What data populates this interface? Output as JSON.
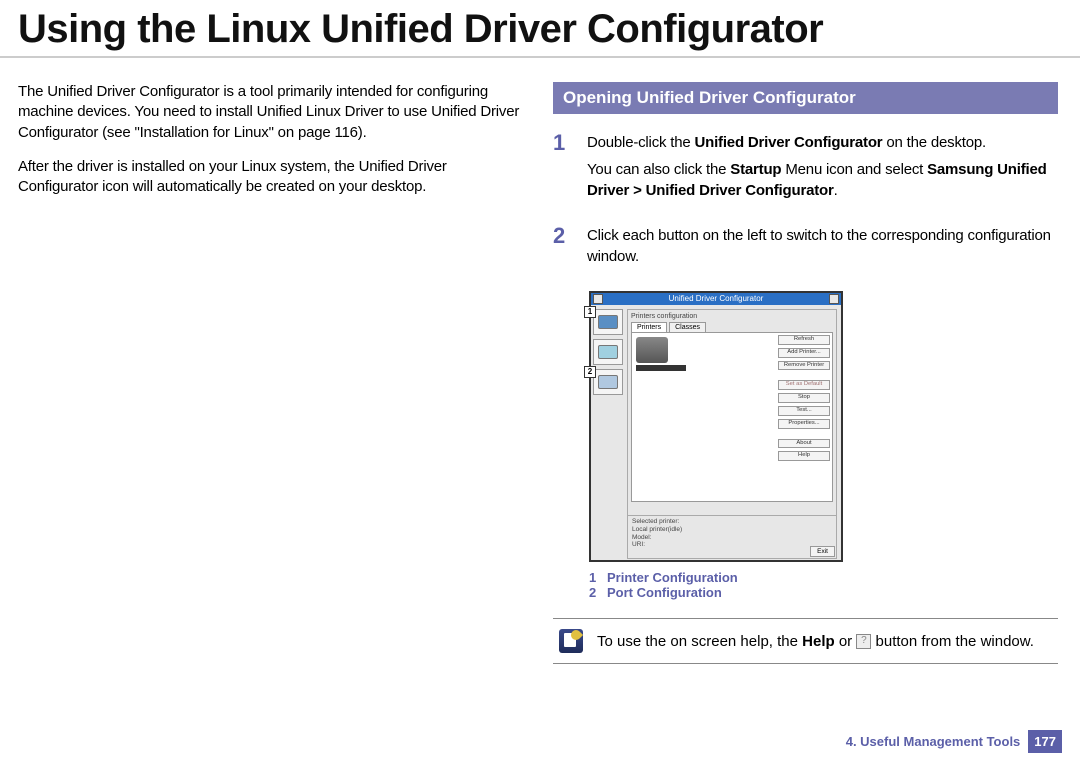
{
  "title": "Using the Linux Unified Driver Configurator",
  "intro": {
    "p1": "The Unified Driver Configurator is a tool primarily intended for configuring machine devices. You need to install Unified Linux Driver to use Unified Driver Configurator (see \"Installation for Linux\" on page 116).",
    "p2": "After the driver is installed on your Linux system, the Unified Driver Configurator icon will automatically be created on your desktop."
  },
  "section_heading": "Opening Unified Driver Configurator",
  "steps": {
    "s1_num": "1",
    "s1_a_pre": "Double-click the ",
    "s1_a_b": "Unified Driver Configurator",
    "s1_a_post": " on the desktop.",
    "s1_b_pre": "You can also click the ",
    "s1_b_b1": "Startup",
    "s1_b_mid": " Menu icon and select ",
    "s1_b_b2": "Samsung Unified Driver",
    "s1_b_gt": " > ",
    "s1_b_b3": "Unified Driver Configurator",
    "s1_b_post": ".",
    "s2_num": "2",
    "s2_text": "Click each button on the left to switch to the corresponding configuration window."
  },
  "shot": {
    "title": "Unified Driver Configurator",
    "panel_label": "Printers configuration",
    "tab1": "Printers",
    "tab2": "Classes",
    "call1": "1",
    "call2": "2",
    "btn_refresh": "Refresh",
    "btn_add": "Add Printer...",
    "btn_remove": "Remove Printer",
    "btn_default": "Set as Default",
    "btn_stop": "Stop",
    "btn_test": "Test...",
    "btn_props": "Properties...",
    "btn_about": "About",
    "btn_help": "Help",
    "sel_header": "Selected printer:",
    "sel_l1": "Local printer(idle)",
    "sel_l2": "Model:",
    "sel_l3": "URI:",
    "btn_exit": "Exit"
  },
  "legend": {
    "n1": "1",
    "t1": "Printer Configuration",
    "n2": "2",
    "t2": "Port Configuration"
  },
  "note": {
    "pre": "To use the on screen help, the ",
    "b": "Help",
    "mid": " or ",
    "q": "?",
    "post": " button from the window."
  },
  "footer": {
    "chapter": "4.  Useful Management Tools",
    "page": "177"
  }
}
